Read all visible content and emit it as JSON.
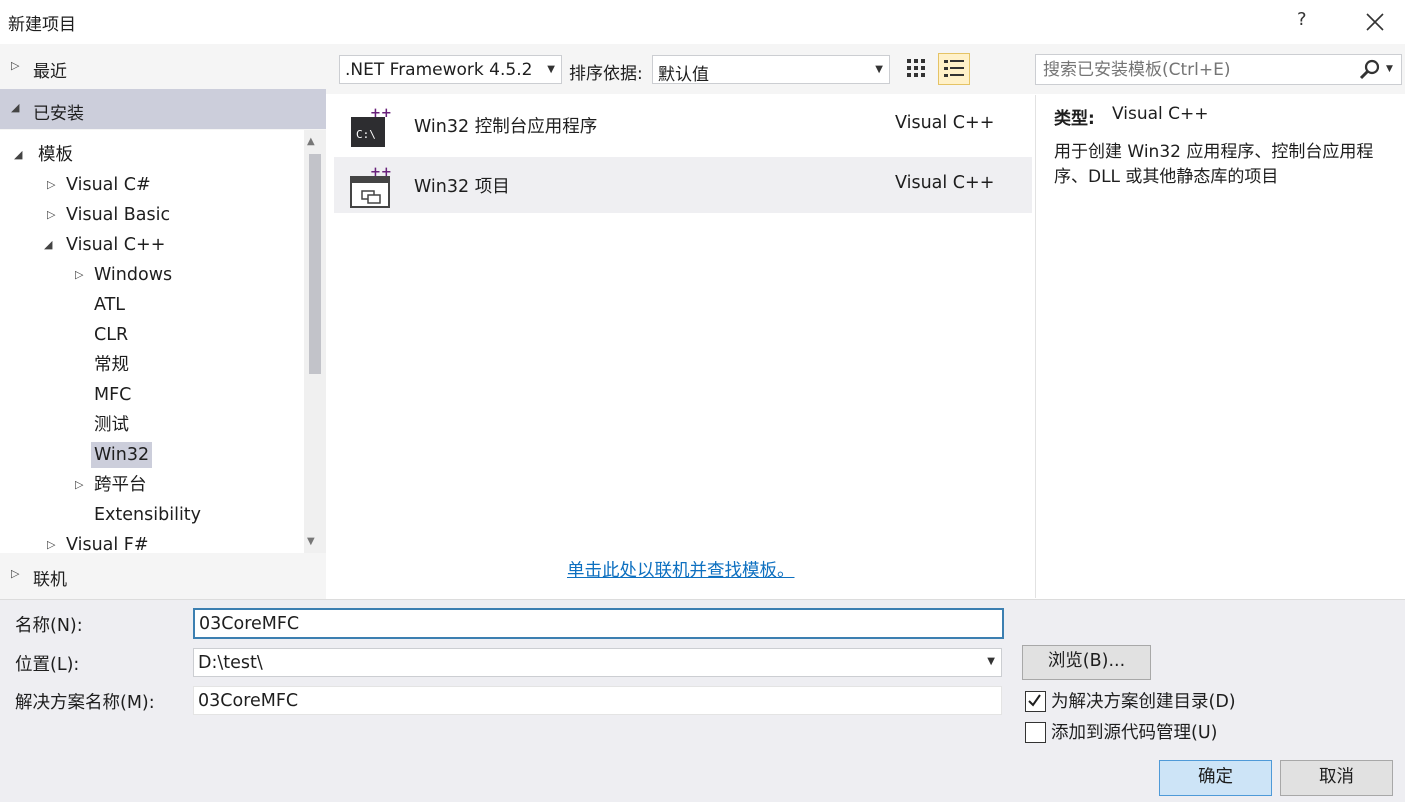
{
  "window": {
    "title": "新建项目",
    "help": "?",
    "close_icon": "close-icon"
  },
  "left": {
    "recent": "最近",
    "installed": "已安装",
    "online": "联机",
    "tree": {
      "templates": "模板",
      "visual_csharp": "Visual C#",
      "visual_basic": "Visual Basic",
      "visual_cpp": "Visual C++",
      "windows": "Windows",
      "atl": "ATL",
      "clr": "CLR",
      "general": "常规",
      "mfc": "MFC",
      "test": "测试",
      "win32": "Win32",
      "cross_platform": "跨平台",
      "extensibility": "Extensibility",
      "visual_fsharp": "Visual F#"
    }
  },
  "toolbar": {
    "framework": ".NET Framework 4.5.2",
    "sort_label": "排序依据:",
    "sort_value": "默认值",
    "search_placeholder": "搜索已安装模板(Ctrl+E)"
  },
  "templates": [
    {
      "name": "Win32 控制台应用程序",
      "lang": "Visual C++",
      "icon": "console-app-icon"
    },
    {
      "name": "Win32 项目",
      "lang": "Visual C++",
      "icon": "win32-project-icon"
    }
  ],
  "online_link": "单击此处以联机并查找模板。",
  "description": {
    "type_label": "类型:",
    "type_value": "Visual C++",
    "text": "用于创建 Win32 应用程序、控制台应用程序、DLL 或其他静态库的项目"
  },
  "form": {
    "name_label": "名称(N):",
    "name_value": "03CoreMFC",
    "location_label": "位置(L):",
    "location_value": "D:\\test\\",
    "solution_label": "解决方案名称(M):",
    "solution_value": "03CoreMFC",
    "browse": "浏览(B)...",
    "create_dir": "为解决方案创建目录(D)",
    "create_dir_checked": true,
    "add_source_control": "添加到源代码管理(U)",
    "add_source_control_checked": false,
    "ok": "确定",
    "cancel": "取消"
  },
  "colors": {
    "accent": "#0e70c0",
    "selection": "#cccedb",
    "ok_button": "#cde4f7",
    "link": "#0e70c0"
  }
}
